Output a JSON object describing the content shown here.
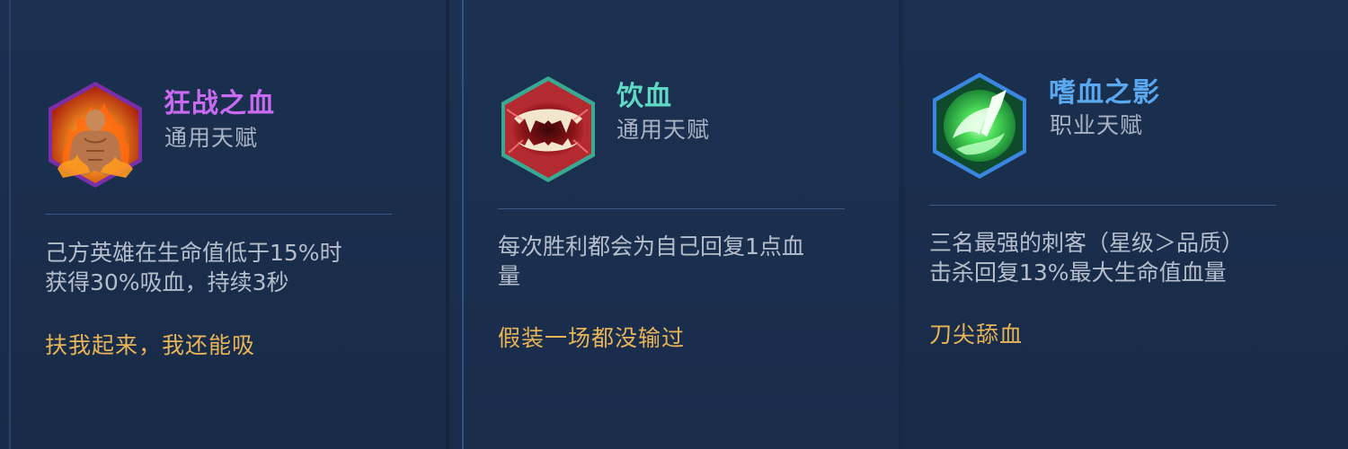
{
  "talents": [
    {
      "name": "狂战之血",
      "name_color": "#c86bf0",
      "type": "通用天赋",
      "description_lines": [
        "己方英雄在生命值低于15%时",
        "获得30%吸血，持续3秒"
      ],
      "flavor": "扶我起来，我还能吸",
      "icon": "berserker-blood-icon",
      "frame_color": "#b45de8"
    },
    {
      "name": "饮血",
      "name_color": "#5fd9c4",
      "type": "通用天赋",
      "description_lines": [
        "每次胜利都会为自己回复1点血",
        "量"
      ],
      "flavor": "假装一场都没输过",
      "icon": "drink-blood-fangs-icon",
      "frame_color": "#3fb6a0"
    },
    {
      "name": "嗜血之影",
      "name_color": "#5aa9f0",
      "type": "职业天赋",
      "description_lines": [
        "三名最强的刺客（星级＞品质）",
        "击杀回复13%最大生命值血量"
      ],
      "flavor": "刀尖舔血",
      "icon": "bloodthirst-shadow-icon",
      "frame_color": "#3c8ee8"
    }
  ],
  "colors": {
    "background": "#182b48",
    "flavor_text": "#e8b458",
    "type_text": "#aab3c4",
    "description_text": "#b6becb",
    "divider": "#3b5a82"
  }
}
